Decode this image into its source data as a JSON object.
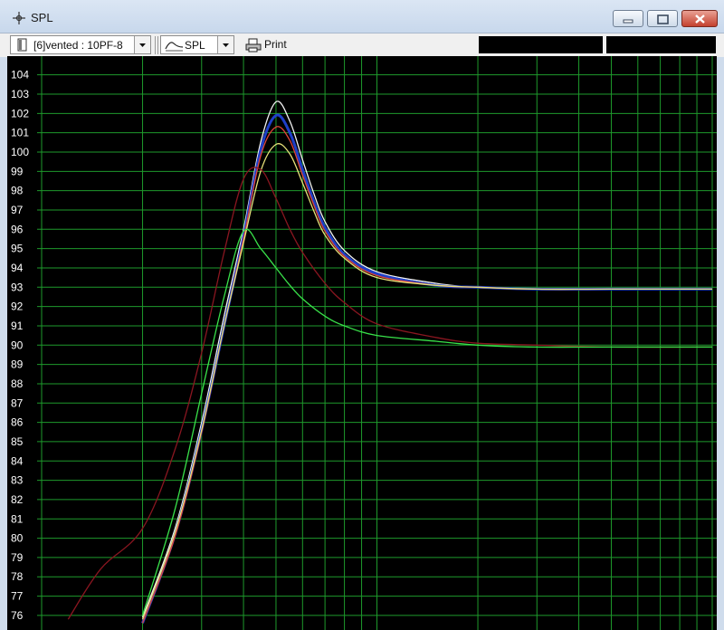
{
  "window": {
    "title": "SPL"
  },
  "toolbar": {
    "model_select": "[6]vented : 10PF-8",
    "curve_select": "SPL",
    "print_label": "Print",
    "model_icon": "document-icon",
    "curve_icon": "spl-curve-icon",
    "print_icon": "printer-icon"
  },
  "colors": {
    "plot_background": "#000000",
    "grid": "#1e9a2c",
    "series_white": "#f2f2f2",
    "series_yellow": "#e8e27a",
    "series_red": "#e0453a",
    "series_blue": "#1f3fc8",
    "series_dark_red": "#8a1620",
    "series_green": "#39e24a"
  },
  "chart_data": {
    "type": "line",
    "ylabel": "",
    "xlabel": "",
    "ylim": [
      75.5,
      104.8
    ],
    "y_ticks": [
      "104",
      "103",
      "102",
      "101",
      "100",
      "99",
      "98",
      "97",
      "96",
      "95",
      "94",
      "93",
      "92",
      "91",
      "90",
      "89",
      "88",
      "87",
      "86",
      "85",
      "84",
      "83",
      "82",
      "81",
      "80",
      "79",
      "78",
      "77",
      "76"
    ],
    "x_scale": "log",
    "x_range_hz": [
      10,
      1000
    ],
    "grid": true,
    "series": [
      {
        "color_key": "series_white",
        "x": [
          20,
          25,
          30,
          35,
          40,
          45,
          50,
          55,
          60,
          65,
          70,
          80,
          100,
          150,
          200,
          300,
          500,
          1000
        ],
        "values": [
          75.9,
          80.5,
          86.0,
          91.5,
          96.0,
          100.5,
          102.6,
          101.6,
          99.6,
          97.8,
          96.4,
          94.9,
          93.8,
          93.2,
          93.0,
          92.9,
          92.9,
          92.9
        ]
      },
      {
        "color_key": "series_blue",
        "x": [
          20,
          25,
          30,
          35,
          40,
          45,
          50,
          55,
          60,
          65,
          70,
          80,
          100,
          150,
          200,
          300,
          500,
          1000
        ],
        "values": [
          75.6,
          80.2,
          85.6,
          91.0,
          95.6,
          100.1,
          101.9,
          101.0,
          99.1,
          97.4,
          96.1,
          94.7,
          93.7,
          93.1,
          93.0,
          92.9,
          92.9,
          92.9
        ]
      },
      {
        "color_key": "series_red",
        "x": [
          20,
          25,
          30,
          35,
          40,
          45,
          50,
          55,
          60,
          65,
          70,
          80,
          100,
          150,
          200,
          300,
          500,
          1000
        ],
        "values": [
          75.6,
          80.1,
          85.5,
          91.0,
          95.5,
          99.8,
          101.3,
          100.6,
          98.8,
          97.2,
          95.9,
          94.6,
          93.6,
          93.1,
          93.0,
          92.9,
          92.9,
          92.9
        ]
      },
      {
        "color_key": "series_yellow",
        "x": [
          20,
          25,
          30,
          35,
          40,
          45,
          50,
          55,
          60,
          65,
          70,
          80,
          100,
          150,
          200,
          300,
          500,
          1000
        ],
        "values": [
          75.8,
          80.3,
          85.6,
          91.0,
          95.3,
          99.0,
          100.4,
          99.9,
          98.4,
          96.9,
          95.7,
          94.5,
          93.5,
          93.1,
          93.0,
          92.9,
          92.9,
          92.9
        ]
      },
      {
        "color_key": "series_dark_red",
        "x": [
          12,
          15,
          20,
          25,
          30,
          35,
          40,
          45,
          50,
          55,
          60,
          70,
          80,
          100,
          150,
          200,
          300,
          500,
          1000
        ],
        "values": [
          75.8,
          78.4,
          80.5,
          84.6,
          89.6,
          94.8,
          98.6,
          99.1,
          97.6,
          96.0,
          94.8,
          93.2,
          92.2,
          91.1,
          90.4,
          90.1,
          90.0,
          89.9,
          89.9
        ]
      },
      {
        "color_key": "series_green",
        "x": [
          20,
          25,
          30,
          35,
          40,
          45,
          50,
          55,
          60,
          70,
          80,
          100,
          150,
          200,
          300,
          500,
          1000
        ],
        "values": [
          76.0,
          81.5,
          87.5,
          92.5,
          95.9,
          95.0,
          94.0,
          93.1,
          92.4,
          91.5,
          91.0,
          90.5,
          90.2,
          90.0,
          89.9,
          89.9,
          89.9
        ]
      }
    ]
  }
}
